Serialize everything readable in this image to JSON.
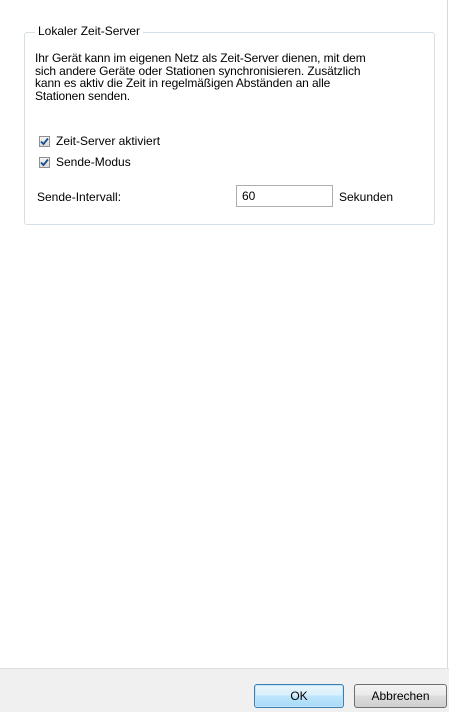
{
  "group": {
    "title": "Lokaler Zeit-Server",
    "description_lines": [
      "Ihr Gerät kann im eigenen Netz als Zeit-Server dienen, mit dem",
      "sich andere Geräte oder Stationen synchronisieren. Zusätzlich",
      "kann es aktiv die Zeit in regelmäßigen Abständen an alle",
      "Stationen senden."
    ]
  },
  "checkboxes": {
    "time_server_enabled": {
      "label": "Zeit-Server aktiviert",
      "checked": true
    },
    "send_mode": {
      "label": "Sende-Modus",
      "checked": true
    }
  },
  "send_interval": {
    "label": "Sende-Intervall:",
    "value": "60",
    "unit": "Sekunden"
  },
  "buttons": {
    "ok_label": "OK",
    "cancel_label": "Abbrechen"
  },
  "colors": {
    "checkmark": "#1a4d8f",
    "group_border": "#d5dfe5",
    "footer_background": "#f0f0f0"
  }
}
